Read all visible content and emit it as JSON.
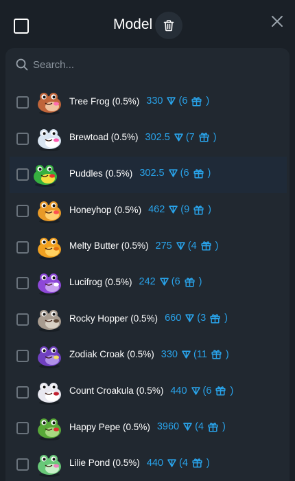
{
  "header": {
    "title": "Model"
  },
  "search": {
    "placeholder": "Search..."
  },
  "colors": {
    "accent": "#29a3ea",
    "background": "#1a2027",
    "panel": "#212830"
  },
  "items": [
    {
      "name": "Tree Frog (0.5%)",
      "price": "330",
      "count": "(6",
      "close": ")",
      "color": "#c0653a",
      "belly": "#f0c4a0",
      "accent": "#ff6fb0",
      "highlight": false
    },
    {
      "name": "Brewtoad (0.5%)",
      "price": "302.5",
      "count": "(7",
      "close": ")",
      "color": "#d8e4f0",
      "belly": "#ffffff",
      "accent": "#ff5ab0",
      "highlight": false
    },
    {
      "name": "Puddles (0.5%)",
      "price": "302.5",
      "count": "(6",
      "close": ")",
      "color": "#36b040",
      "belly": "#f4e040",
      "accent": "#e83030",
      "highlight": true
    },
    {
      "name": "Honeyhop (0.5%)",
      "price": "462",
      "count": "(9",
      "close": ")",
      "color": "#e89a28",
      "belly": "#ffd070",
      "accent": "#ff5050",
      "highlight": false
    },
    {
      "name": "Melty Butter (0.5%)",
      "price": "275",
      "count": "(4",
      "close": ")",
      "color": "#f0a020",
      "belly": "#ffd060",
      "accent": "#e07010",
      "highlight": false
    },
    {
      "name": "Lucifrog (0.5%)",
      "price": "242",
      "count": "(6",
      "close": ")",
      "color": "#8e48d8",
      "belly": "#c8a0f0",
      "accent": "#ffffff",
      "highlight": false
    },
    {
      "name": "Rocky Hopper (0.5%)",
      "price": "660",
      "count": "(3",
      "close": ")",
      "color": "#a89c90",
      "belly": "#d8d0c4",
      "accent": "#604a3a",
      "highlight": false
    },
    {
      "name": "Zodiak Croak (0.5%)",
      "price": "330",
      "count": "(11",
      "close": ")",
      "color": "#7040c0",
      "belly": "#b090e8",
      "accent": "#f0e060",
      "highlight": false
    },
    {
      "name": "Count Croakula (0.5%)",
      "price": "440",
      "count": "(6",
      "close": ")",
      "color": "#e8e8f0",
      "belly": "#ffffff",
      "accent": "#c02030",
      "highlight": false
    },
    {
      "name": "Happy Pepe (0.5%)",
      "price": "3960",
      "count": "(4",
      "close": ")",
      "color": "#58a838",
      "belly": "#a8d880",
      "accent": "#e03030",
      "highlight": false
    },
    {
      "name": "Lilie Pond (0.5%)",
      "price": "440",
      "count": "(4",
      "close": ")",
      "color": "#68c878",
      "belly": "#c8f0c8",
      "accent": "#f080c0",
      "highlight": false
    }
  ]
}
